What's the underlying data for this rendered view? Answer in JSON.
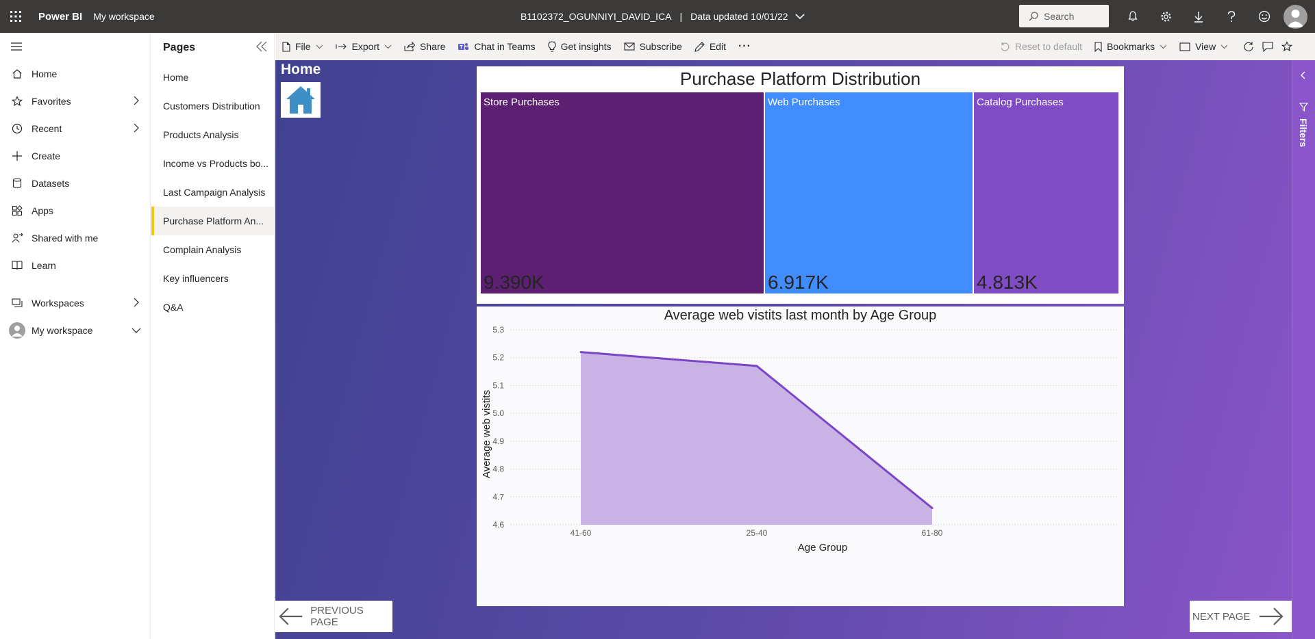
{
  "header": {
    "brand": "Power BI",
    "workspace": "My workspace",
    "report_name": "B1102372_OGUNNIYI_DAVID_ICA",
    "separator": "|",
    "data_updated": "Data updated 10/01/22",
    "search_placeholder": "Search"
  },
  "leftnav": {
    "items": [
      {
        "label": "Home",
        "icon": "home-icon"
      },
      {
        "label": "Favorites",
        "icon": "star-icon",
        "chevron": true
      },
      {
        "label": "Recent",
        "icon": "clock-icon",
        "chevron": true
      },
      {
        "label": "Create",
        "icon": "plus-icon"
      },
      {
        "label": "Datasets",
        "icon": "database-icon"
      },
      {
        "label": "Apps",
        "icon": "apps-icon"
      },
      {
        "label": "Shared with me",
        "icon": "shared-icon"
      },
      {
        "label": "Learn",
        "icon": "book-icon"
      }
    ],
    "workspaces": "Workspaces",
    "my_workspace": "My workspace"
  },
  "pages": {
    "title": "Pages",
    "items": [
      "Home",
      "Customers Distribution",
      "Products Analysis",
      "Income vs Products bo...",
      "Last Campaign Analysis",
      "Purchase Platform An...",
      "Complain Analysis",
      "Key influencers",
      "Q&A"
    ],
    "active_index": 5
  },
  "actionbar": {
    "file": "File",
    "export": "Export",
    "share": "Share",
    "chat": "Chat in Teams",
    "insights": "Get insights",
    "subscribe": "Subscribe",
    "edit": "Edit",
    "more": "···",
    "reset": "Reset to default",
    "bookmarks": "Bookmarks",
    "view": "View"
  },
  "canvas": {
    "home_title": "Home",
    "prev_page": "PREVIOUS PAGE",
    "next_page": "NEXT PAGE",
    "filters_label": "Filters"
  },
  "treemap": {
    "title": "Purchase Platform Distribution",
    "cells": [
      {
        "label": "Store Purchases",
        "value": "9.390K",
        "color": "#5c1f72"
      },
      {
        "label": "Web Purchases",
        "value": "6.917K",
        "color": "#418dff"
      },
      {
        "label": "Catalog Purchases",
        "value": "4.813K",
        "color": "#7f4cc6"
      }
    ]
  },
  "chart_data": {
    "type": "area",
    "title": "Average web vistits last month by Age Group",
    "xlabel": "Age Group",
    "ylabel": "Average web vistits",
    "categories": [
      "41-60",
      "25-40",
      "61-80"
    ],
    "values": [
      5.22,
      5.17,
      4.66
    ],
    "ylim": [
      4.6,
      5.3
    ],
    "yticks": [
      "5.3",
      "5.2",
      "5.1",
      "5.0",
      "4.9",
      "4.8",
      "4.7",
      "4.6"
    ],
    "line_color": "#7b45c8",
    "fill_color": "#c9b3e4",
    "grid": true
  }
}
